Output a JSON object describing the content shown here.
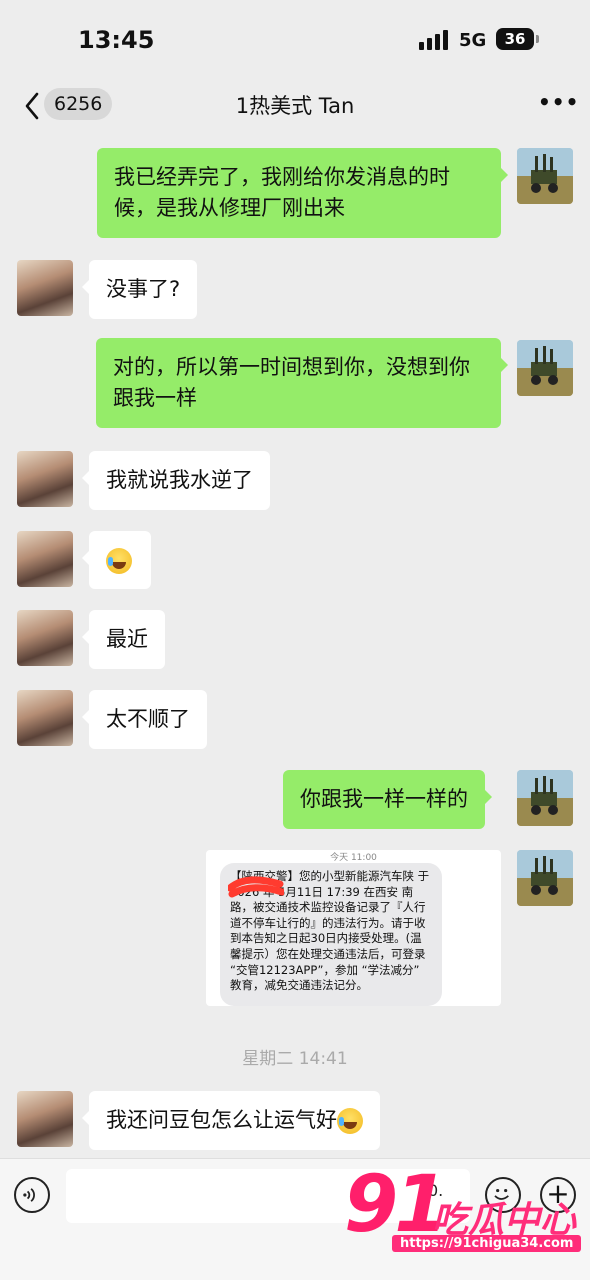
{
  "status": {
    "time": "13:45",
    "network": "5G",
    "battery": "36"
  },
  "nav": {
    "back_badge": "6256",
    "title": "1热美式 Tan"
  },
  "messages": [
    {
      "from": "me",
      "text": "我已经弄完了，我刚给你发消息的时候，是我从修理厂刚出来"
    },
    {
      "from": "them",
      "text": "没事了?"
    },
    {
      "from": "me",
      "text": "对的，所以第一时间想到你，没想到你跟我一样"
    },
    {
      "from": "them",
      "text": "我就说我水逆了"
    },
    {
      "from": "them",
      "text": ""
    },
    {
      "from": "them",
      "text": "最近"
    },
    {
      "from": "them",
      "text": "太不顺了"
    },
    {
      "from": "me",
      "text": "你跟我一样一样的"
    },
    {
      "from": "them",
      "text": "我还问豆包怎么让运气好"
    }
  ],
  "image_message": {
    "time": "今天 11:00",
    "sms_text": "【陕西交警】您的小型新能源汽车陕 于 2026 年 5月11日 17:39 在西安 南路，被交通技术监控设备记录了『人行道不停车让行的』的违法行为。请于收到本告知之日起30日内接受处理。(温馨提示）您在处理交通违法后，可登录 “交管12123APP”，参加 “学法减分” 教育，减免交通违法记分。"
  },
  "timestamp": "星期二 14:41",
  "input": {
    "hint": "0."
  },
  "watermark": {
    "number": "91",
    "text": "吃瓜中心",
    "url": "https://91chigua34.com"
  }
}
